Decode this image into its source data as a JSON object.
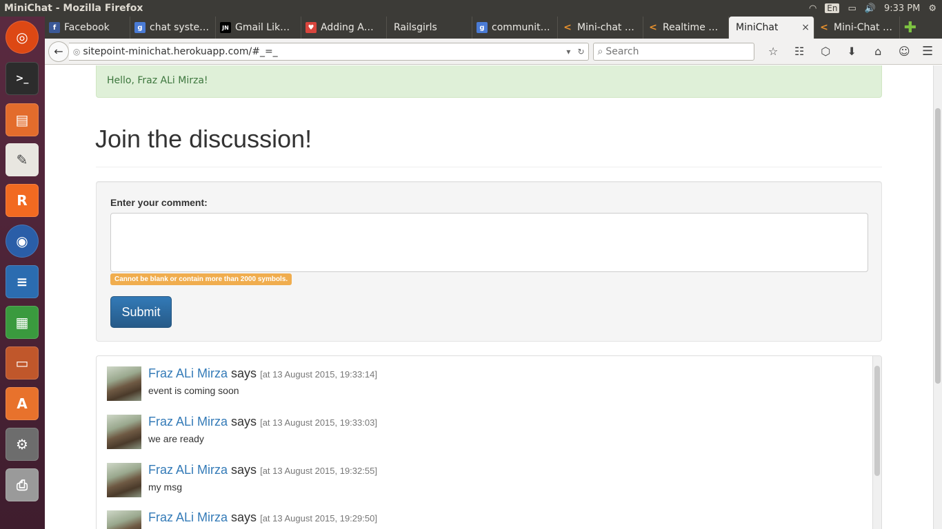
{
  "window": {
    "title": "MiniChat - Mozilla Firefox"
  },
  "system": {
    "lang": "En",
    "time": "9:33 PM"
  },
  "launcher": [
    {
      "name": "ubuntu-dash-icon"
    },
    {
      "name": "terminal-icon"
    },
    {
      "name": "files-icon"
    },
    {
      "name": "text-editor-icon"
    },
    {
      "name": "rubymine-icon"
    },
    {
      "name": "firefox-icon"
    },
    {
      "name": "writer-icon"
    },
    {
      "name": "calc-icon"
    },
    {
      "name": "impress-icon"
    },
    {
      "name": "software-center-icon"
    },
    {
      "name": "system-settings-icon"
    },
    {
      "name": "printer-icon"
    }
  ],
  "tabs": [
    {
      "label": "Facebook",
      "icon": "f",
      "color": "#3b5998"
    },
    {
      "label": "chat syste…",
      "icon": "g",
      "color": "#4a7bd5"
    },
    {
      "label": "Gmail Lik…",
      "icon": "JN",
      "color": "#000000"
    },
    {
      "label": "Adding A…",
      "icon": "♥",
      "color": "#d9453d"
    },
    {
      "label": "Railsgirls",
      "icon": "",
      "color": ""
    },
    {
      "label": "communit…",
      "icon": "g",
      "color": "#4a7bd5"
    },
    {
      "label": "Mini-chat …",
      "icon": "<",
      "color": "#e8912d"
    },
    {
      "label": "Realtime …",
      "icon": "<",
      "color": "#e8912d"
    },
    {
      "label": "MiniChat",
      "icon": "",
      "color": "",
      "active": true,
      "close": "×"
    },
    {
      "label": "Mini-Chat …",
      "icon": "<",
      "color": "#e8912d"
    }
  ],
  "nav": {
    "url": "sitepoint-minichat.herokuapp.com/#_=_",
    "search_placeholder": "Search"
  },
  "page": {
    "alert": "Hello, Fraz ALi Mirza!",
    "heading": "Join the discussion!",
    "form": {
      "label": "Enter your comment:",
      "value": "",
      "hint": "Cannot be blank or contain more than 2000 symbols.",
      "submit": "Submit"
    },
    "comments": [
      {
        "name": "Fraz ALi Mirza",
        "says": "says",
        "ts": "[at 13 August 2015, 19:33:14]",
        "text": "event is coming soon"
      },
      {
        "name": "Fraz ALi Mirza",
        "says": "says",
        "ts": "[at 13 August 2015, 19:33:03]",
        "text": "we are ready"
      },
      {
        "name": "Fraz ALi Mirza",
        "says": "says",
        "ts": "[at 13 August 2015, 19:32:55]",
        "text": "my msg"
      },
      {
        "name": "Fraz ALi Mirza",
        "says": "says",
        "ts": "[at 13 August 2015, 19:29:50]",
        "text": ""
      }
    ]
  }
}
